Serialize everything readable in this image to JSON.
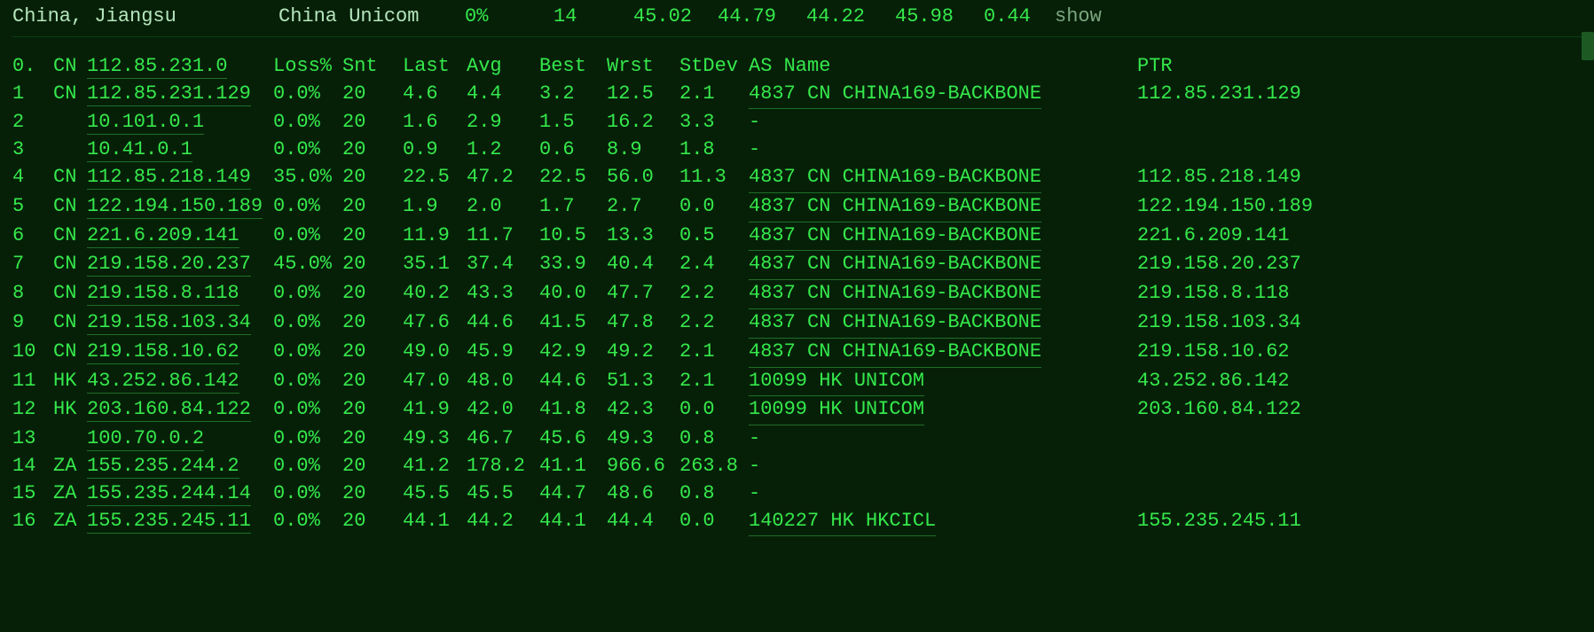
{
  "topbar": {
    "location": "China, Jiangsu",
    "isp": "China Unicom",
    "loss": "0%",
    "snt": "14",
    "last": "45.02",
    "avg": "44.79",
    "best": "44.22",
    "wrst": "45.98",
    "stdev": "0.44",
    "action": "show"
  },
  "headers": {
    "idx": "0.",
    "cc": "CN",
    "ip": "112.85.231.0",
    "loss": "Loss%",
    "snt": "Snt",
    "last": "Last",
    "avg": "Avg",
    "best": "Best",
    "wrst": "Wrst",
    "stdev": "StDev",
    "asname": "AS Name",
    "ptr": "PTR"
  },
  "hops": [
    {
      "idx": "1",
      "cc": "CN",
      "ip": "112.85.231.129",
      "loss": "0.0%",
      "snt": "20",
      "last": "4.6",
      "avg": "4.4",
      "best": "3.2",
      "wrst": "12.5",
      "stdev": "2.1",
      "asn": "4837  CN CHINA169-BACKBONE",
      "ptr": "112.85.231.129"
    },
    {
      "idx": "2",
      "cc": "",
      "ip": "10.101.0.1",
      "loss": "0.0%",
      "snt": "20",
      "last": "1.6",
      "avg": "2.9",
      "best": "1.5",
      "wrst": "16.2",
      "stdev": "3.3",
      "asn": "-",
      "ptr": ""
    },
    {
      "idx": "3",
      "cc": "",
      "ip": "10.41.0.1",
      "loss": "0.0%",
      "snt": "20",
      "last": "0.9",
      "avg": "1.2",
      "best": "0.6",
      "wrst": "8.9",
      "stdev": "1.8",
      "asn": "-",
      "ptr": ""
    },
    {
      "idx": "4",
      "cc": "CN",
      "ip": "112.85.218.149",
      "loss": "35.0%",
      "snt": "20",
      "last": "22.5",
      "avg": "47.2",
      "best": "22.5",
      "wrst": "56.0",
      "stdev": "11.3",
      "asn": "4837  CN CHINA169-BACKBONE",
      "ptr": "112.85.218.149"
    },
    {
      "idx": "5",
      "cc": "CN",
      "ip": "122.194.150.189",
      "loss": "0.0%",
      "snt": "20",
      "last": "1.9",
      "avg": "2.0",
      "best": "1.7",
      "wrst": "2.7",
      "stdev": "0.0",
      "asn": "4837  CN CHINA169-BACKBONE",
      "ptr": "122.194.150.189"
    },
    {
      "idx": "6",
      "cc": "CN",
      "ip": "221.6.209.141",
      "loss": "0.0%",
      "snt": "20",
      "last": "11.9",
      "avg": "11.7",
      "best": "10.5",
      "wrst": "13.3",
      "stdev": "0.5",
      "asn": "4837  CN CHINA169-BACKBONE",
      "ptr": "221.6.209.141"
    },
    {
      "idx": "7",
      "cc": "CN",
      "ip": "219.158.20.237",
      "loss": "45.0%",
      "snt": "20",
      "last": "35.1",
      "avg": "37.4",
      "best": "33.9",
      "wrst": "40.4",
      "stdev": "2.4",
      "asn": "4837  CN CHINA169-BACKBONE",
      "ptr": "219.158.20.237"
    },
    {
      "idx": "8",
      "cc": "CN",
      "ip": "219.158.8.118",
      "loss": "0.0%",
      "snt": "20",
      "last": "40.2",
      "avg": "43.3",
      "best": "40.0",
      "wrst": "47.7",
      "stdev": "2.2",
      "asn": "4837  CN CHINA169-BACKBONE",
      "ptr": "219.158.8.118"
    },
    {
      "idx": "9",
      "cc": "CN",
      "ip": "219.158.103.34",
      "loss": "0.0%",
      "snt": "20",
      "last": "47.6",
      "avg": "44.6",
      "best": "41.5",
      "wrst": "47.8",
      "stdev": "2.2",
      "asn": "4837  CN CHINA169-BACKBONE",
      "ptr": "219.158.103.34"
    },
    {
      "idx": "10",
      "cc": "CN",
      "ip": "219.158.10.62",
      "loss": "0.0%",
      "snt": "20",
      "last": "49.0",
      "avg": "45.9",
      "best": "42.9",
      "wrst": "49.2",
      "stdev": "2.1",
      "asn": "4837  CN CHINA169-BACKBONE",
      "ptr": "219.158.10.62"
    },
    {
      "idx": "11",
      "cc": "HK",
      "ip": "43.252.86.142",
      "loss": "0.0%",
      "snt": "20",
      "last": "47.0",
      "avg": "48.0",
      "best": "44.6",
      "wrst": "51.3",
      "stdev": "2.1",
      "asn": "10099 HK UNICOM",
      "ptr": "43.252.86.142"
    },
    {
      "idx": "12",
      "cc": "HK",
      "ip": "203.160.84.122",
      "loss": "0.0%",
      "snt": "20",
      "last": "41.9",
      "avg": "42.0",
      "best": "41.8",
      "wrst": "42.3",
      "stdev": "0.0",
      "asn": "10099 HK UNICOM",
      "ptr": "203.160.84.122"
    },
    {
      "idx": "13",
      "cc": "",
      "ip": "100.70.0.2",
      "loss": "0.0%",
      "snt": "20",
      "last": "49.3",
      "avg": "46.7",
      "best": "45.6",
      "wrst": "49.3",
      "stdev": "0.8",
      "asn": "-",
      "ptr": ""
    },
    {
      "idx": "14",
      "cc": "ZA",
      "ip": "155.235.244.2",
      "loss": "0.0%",
      "snt": "20",
      "last": "41.2",
      "avg": "178.2",
      "best": "41.1",
      "wrst": "966.6",
      "stdev": "263.8",
      "asn": "-",
      "ptr": ""
    },
    {
      "idx": "15",
      "cc": "ZA",
      "ip": "155.235.244.14",
      "loss": "0.0%",
      "snt": "20",
      "last": "45.5",
      "avg": "45.5",
      "best": "44.7",
      "wrst": "48.6",
      "stdev": "0.8",
      "asn": "-",
      "ptr": ""
    },
    {
      "idx": "16",
      "cc": "ZA",
      "ip": "155.235.245.11",
      "loss": "0.0%",
      "snt": "20",
      "last": "44.1",
      "avg": "44.2",
      "best": "44.1",
      "wrst": "44.4",
      "stdev": "0.0",
      "asn": "140227 HK HKCICL",
      "ptr": "155.235.245.11"
    }
  ]
}
